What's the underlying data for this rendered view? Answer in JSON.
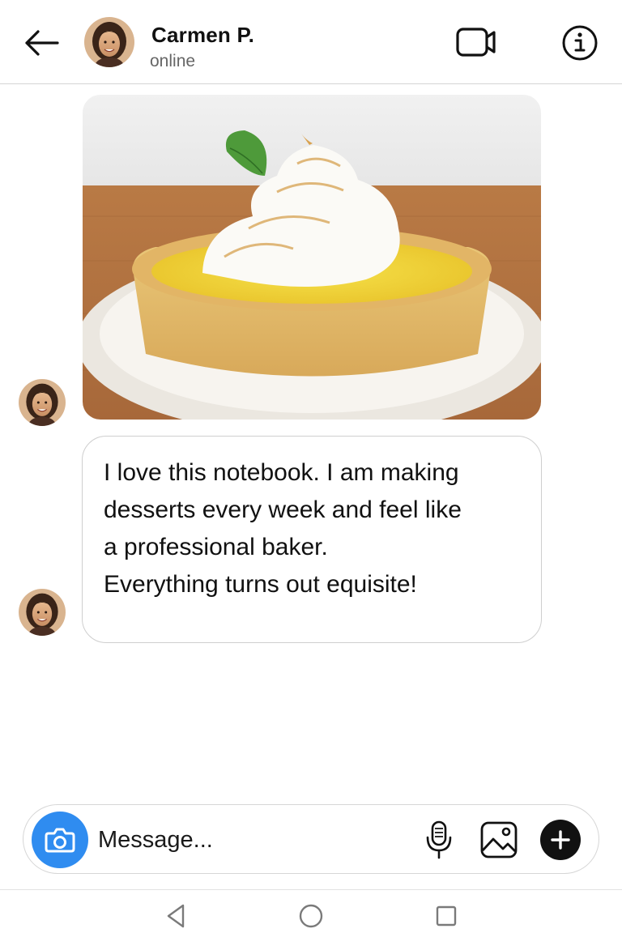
{
  "header": {
    "contact_name": "Carmen P.",
    "status": "online",
    "icons": [
      "arrow-left-icon",
      "video-camera-icon",
      "info-icon"
    ]
  },
  "messages": [
    {
      "type": "image",
      "content": "lemon meringue tart on a white plate"
    },
    {
      "type": "text",
      "lines": [
        "I love this notebook. I am making",
        "desserts every week and feel like",
        "a professional baker.",
        "Everything turns out equisite!"
      ]
    }
  ],
  "composer": {
    "placeholder": "Message...",
    "icons": [
      "camera-icon",
      "microphone-icon",
      "image-icon",
      "plus-icon"
    ]
  },
  "navigation": {
    "icons": [
      "back-triangle-icon",
      "home-circle-icon",
      "recents-square-icon"
    ]
  },
  "colors": {
    "accent": "#2f8cf0",
    "divider": "#d4d4d4",
    "bubble_border": "#cfcfcf",
    "text": "#111111",
    "status": "#666666"
  }
}
